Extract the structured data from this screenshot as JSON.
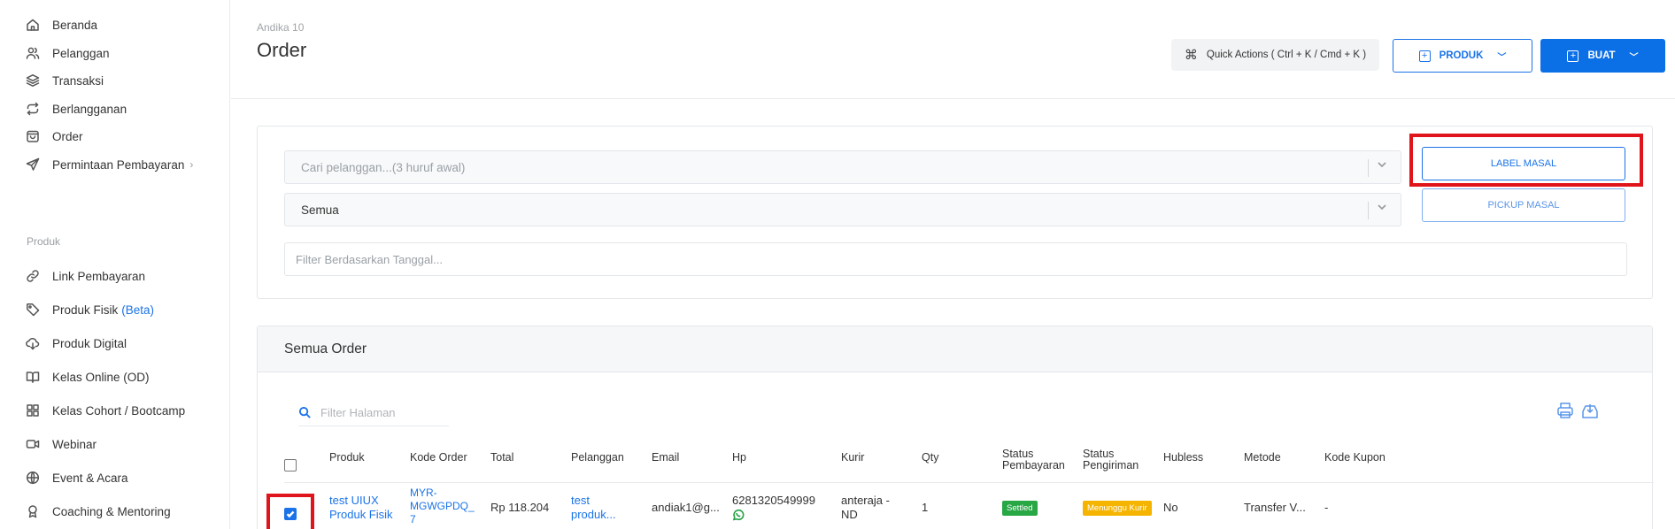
{
  "sidebar": {
    "items": [
      {
        "label": "Beranda",
        "icon": "home-icon"
      },
      {
        "label": "Pelanggan",
        "icon": "users-icon"
      },
      {
        "label": "Transaksi",
        "icon": "layers-icon"
      },
      {
        "label": "Berlangganan",
        "icon": "repeat-icon"
      },
      {
        "label": "Order",
        "icon": "bag-icon"
      },
      {
        "label": "Permintaan Pembayaran",
        "icon": "send-icon",
        "chevron": "›"
      }
    ],
    "section_produk": "Produk",
    "produk_items": [
      {
        "label": "Link Pembayaran",
        "icon": "link-icon"
      },
      {
        "label": "Produk Fisik",
        "badge": "(Beta)",
        "icon": "tag-icon"
      },
      {
        "label": "Produk Digital",
        "icon": "cloud-download-icon"
      },
      {
        "label": "Kelas Online (OD)",
        "icon": "book-icon"
      },
      {
        "label": "Kelas Cohort / Bootcamp",
        "icon": "grid-icon"
      },
      {
        "label": "Webinar",
        "icon": "video-icon"
      },
      {
        "label": "Event & Acara",
        "icon": "globe-icon"
      },
      {
        "label": "Coaching & Mentoring",
        "icon": "award-icon"
      }
    ]
  },
  "header": {
    "breadcrumb": "Andika 10",
    "title": "Order",
    "quick_actions": "Quick Actions ( Ctrl + K / Cmd + K )",
    "produk_button": "PRODUK",
    "buat_button": "BUAT"
  },
  "filters": {
    "customer_placeholder": "Cari pelanggan...(3 huruf awal)",
    "status_value": "Semua",
    "date_placeholder": "Filter Berdasarkan Tanggal...",
    "label_masal": "LABEL MASAL",
    "pickup_masal": "PICKUP MASAL"
  },
  "orders": {
    "title": "Semua Order",
    "search_placeholder": "Filter Halaman",
    "columns": {
      "produk": "Produk",
      "kode_order": "Kode Order",
      "total": "Total",
      "pelanggan": "Pelanggan",
      "email": "Email",
      "hp": "Hp",
      "kurir": "Kurir",
      "qty": "Qty",
      "status_pembayaran_1": "Status",
      "status_pembayaran_2": "Pembayaran",
      "status_pengiriman_1": "Status",
      "status_pengiriman_2": "Pengiriman",
      "hubless": "Hubless",
      "metode": "Metode",
      "kode_kupon": "Kode Kupon"
    },
    "rows": [
      {
        "checked": true,
        "produk_1": "test UIUX",
        "produk_2": "Produk Fisik",
        "kode_1": "MYR-",
        "kode_2": "MGWGPDQ_",
        "kode_3": "7",
        "total": "Rp 118.204",
        "pelanggan_1": "test",
        "pelanggan_2": "produk...",
        "email": "andiak1@g...",
        "hp": "6281320549999",
        "kurir_1": "anteraja -",
        "kurir_2": "ND",
        "qty": "1",
        "status_pembayaran": "Settled",
        "status_pengiriman": "Menunggu Kurir",
        "hubless": "No",
        "metode": "Transfer V...",
        "kode_kupon": "-"
      }
    ]
  },
  "colors": {
    "primary": "#1a73e8",
    "highlight": "#e0141b",
    "settled": "#28a745",
    "waiting": "#f5b400"
  }
}
